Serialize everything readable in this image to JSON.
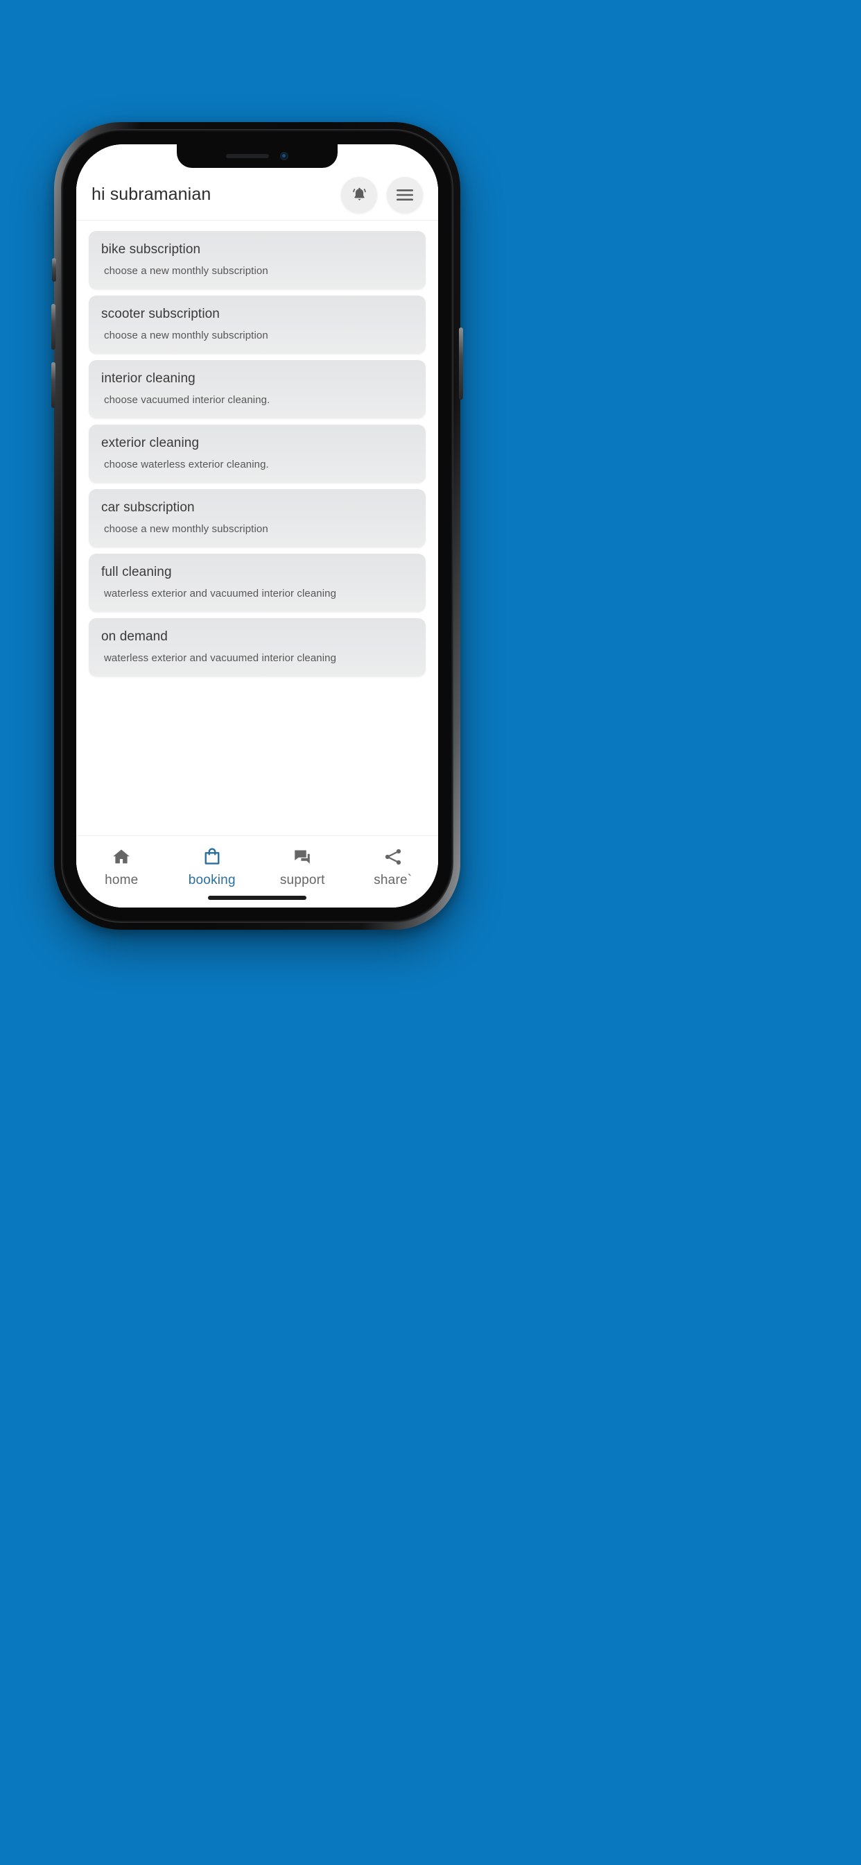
{
  "background_color": "#0a78be",
  "app": {
    "header": {
      "greeting": "hi subramanian",
      "notification_icon": "bell-icon",
      "menu_icon": "hamburger-menu-icon"
    },
    "services": [
      {
        "title": "bike subscription",
        "subtitle": "choose a new monthly subscription"
      },
      {
        "title": "scooter subscription",
        "subtitle": "choose a new monthly subscription"
      },
      {
        "title": "interior cleaning",
        "subtitle": "choose vacuumed interior cleaning."
      },
      {
        "title": "exterior cleaning",
        "subtitle": "choose waterless exterior cleaning."
      },
      {
        "title": "car subscription",
        "subtitle": "choose a new monthly subscription"
      },
      {
        "title": "full cleaning",
        "subtitle": "waterless exterior and vacuumed interior cleaning"
      },
      {
        "title": "on demand",
        "subtitle": "waterless exterior and vacuumed interior cleaning"
      }
    ],
    "bottom_nav": {
      "active_color": "#2a6f9e",
      "inactive_color": "#666666",
      "items": [
        {
          "label": "home",
          "icon": "home-icon",
          "active": false
        },
        {
          "label": "booking",
          "icon": "shopping-bag-icon",
          "active": true
        },
        {
          "label": "support",
          "icon": "chat-bubbles-icon",
          "active": false
        },
        {
          "label": "share`",
          "icon": "share-nodes-icon",
          "active": false
        }
      ]
    }
  }
}
